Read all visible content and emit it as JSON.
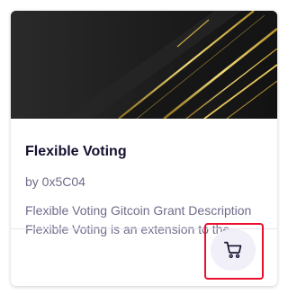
{
  "card": {
    "banner_name": "abstract-gold-stripes-banner",
    "title": "Flexible Voting",
    "author": "by 0x5C04",
    "description_lines": [
      "Flexible Voting Gitcoin Grant Description",
      "Flexible Voting is an extension to the"
    ],
    "cart_icon": "shopping-cart-icon"
  },
  "colors": {
    "banner_bg": "#1e1e1e",
    "gold": "#d9b847",
    "title": "#14102f",
    "muted": "#6f6c8a",
    "cart_button_bg": "#f1eff8",
    "highlight": "#e8102c"
  }
}
